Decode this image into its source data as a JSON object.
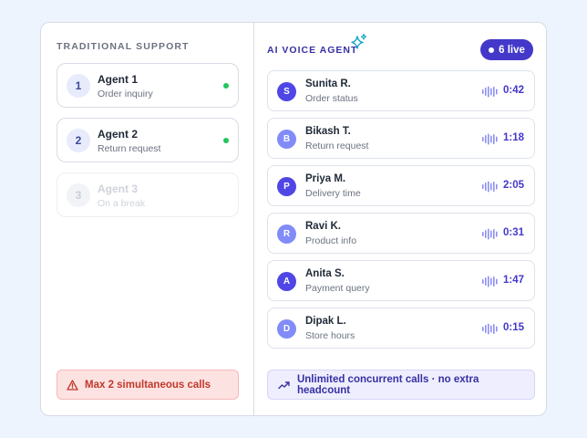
{
  "traditional": {
    "title": "TRADITIONAL SUPPORT",
    "agents": [
      {
        "number": "1",
        "name": "Agent 1",
        "status": "Order inquiry",
        "active": true
      },
      {
        "number": "2",
        "name": "Agent 2",
        "status": "Return request",
        "active": true
      },
      {
        "number": "3",
        "name": "Agent 3",
        "status": "On a break",
        "active": false
      }
    ],
    "warning": "Max 2 simultaneous calls",
    "warning_icon": "warning-triangle-icon"
  },
  "ai": {
    "title": "AI VOICE AGENT",
    "title_icon": "sparkle-icon",
    "live_badge": "6 live",
    "calls": [
      {
        "initial": "S",
        "name": "Sunita R.",
        "topic": "Order status",
        "duration": "0:42",
        "color": "#4f46e5"
      },
      {
        "initial": "B",
        "name": "Bikash T.",
        "topic": "Return request",
        "duration": "1:18",
        "color": "#818cf8"
      },
      {
        "initial": "P",
        "name": "Priya M.",
        "topic": "Delivery time",
        "duration": "2:05",
        "color": "#4f46e5"
      },
      {
        "initial": "R",
        "name": "Ravi K.",
        "topic": "Product info",
        "duration": "0:31",
        "color": "#818cf8"
      },
      {
        "initial": "A",
        "name": "Anita S.",
        "topic": "Payment query",
        "duration": "1:47",
        "color": "#4f46e5"
      },
      {
        "initial": "D",
        "name": "Dipak L.",
        "topic": "Store hours",
        "duration": "0:15",
        "color": "#818cf8"
      }
    ],
    "note": "Unlimited concurrent calls · no extra headcount",
    "note_icon": "trending-up-icon"
  }
}
